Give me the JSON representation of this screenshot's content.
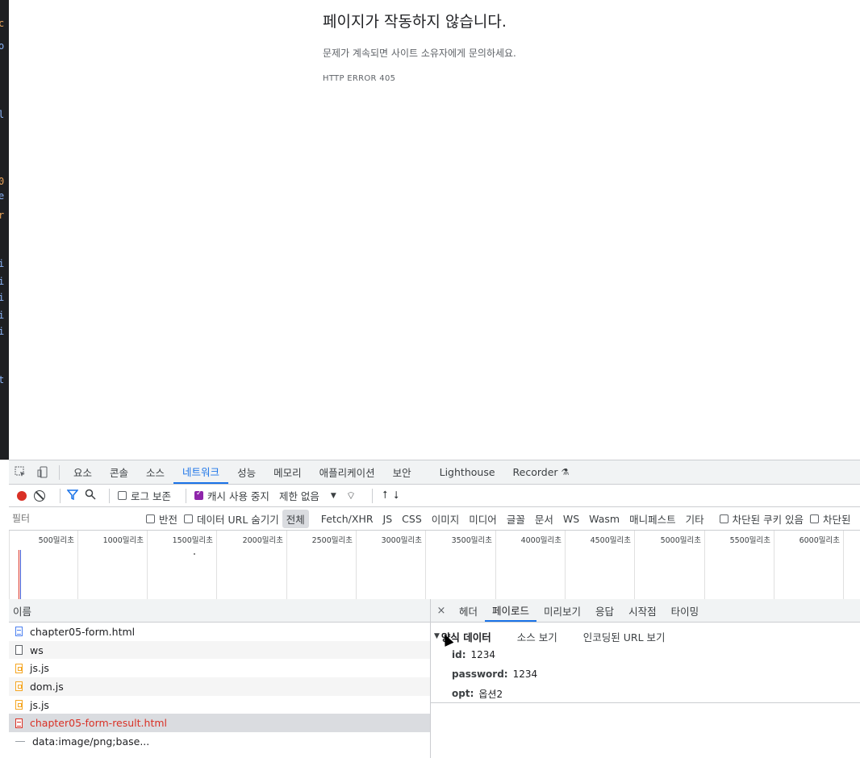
{
  "error_page": {
    "title": "페이지가 작동하지 않습니다.",
    "description": "문제가 계속되면 사이트 소유자에게 문의하세요.",
    "code": "HTTP ERROR 405"
  },
  "devtools": {
    "tabs": [
      "요소",
      "콘솔",
      "소스",
      "네트워크",
      "성능",
      "메모리",
      "애플리케이션",
      "보안",
      "Lighthouse",
      "Recorder"
    ],
    "active_tab": "네트워크",
    "toolbar": {
      "preserve_log": "로그 보존",
      "disable_cache": "캐시 사용 중지",
      "throttle": "제한 없음"
    },
    "filter": {
      "placeholder": "필터",
      "invert": "반전",
      "hide_data_urls": "데이터 URL 숨기기",
      "types": [
        "전체",
        "Fetch/XHR",
        "JS",
        "CSS",
        "이미지",
        "미디어",
        "글꼴",
        "문서",
        "WS",
        "Wasm",
        "매니페스트",
        "기타"
      ],
      "selected_type": "전체",
      "blocked_cookies": "차단된 쿠키 있음",
      "blocked_requests": "차단된"
    },
    "timeline_ticks": [
      "500밀리초",
      "1000밀리초",
      "1500밀리초",
      "2000밀리초",
      "2500밀리초",
      "3000밀리초",
      "3500밀리초",
      "4000밀리초",
      "4500밀리초",
      "5000밀리초",
      "5500밀리초",
      "6000밀리초"
    ],
    "requests_header": "이름",
    "requests": [
      {
        "name": "chapter05-form.html",
        "icon": "document"
      },
      {
        "name": "ws",
        "icon": "websocket"
      },
      {
        "name": "js.js",
        "icon": "script"
      },
      {
        "name": "dom.js",
        "icon": "script"
      },
      {
        "name": "js.js",
        "icon": "script"
      },
      {
        "name": "chapter05-form-result.html",
        "icon": "document-error"
      },
      {
        "name": "data:image/png;base...",
        "icon": "data"
      }
    ],
    "detail_tabs": [
      "헤더",
      "페이로드",
      "미리보기",
      "응답",
      "시작점",
      "타이밍"
    ],
    "active_detail_tab": "페이로드",
    "payload": {
      "section_title": "양식 데이터",
      "view_source": "소스 보기",
      "view_url_encoded": "인코딩된 URL 보기",
      "fields": [
        {
          "key": "id:",
          "value": "1234"
        },
        {
          "key": "password:",
          "value": "1234"
        },
        {
          "key": "opt:",
          "value": "옵션2"
        }
      ]
    }
  }
}
